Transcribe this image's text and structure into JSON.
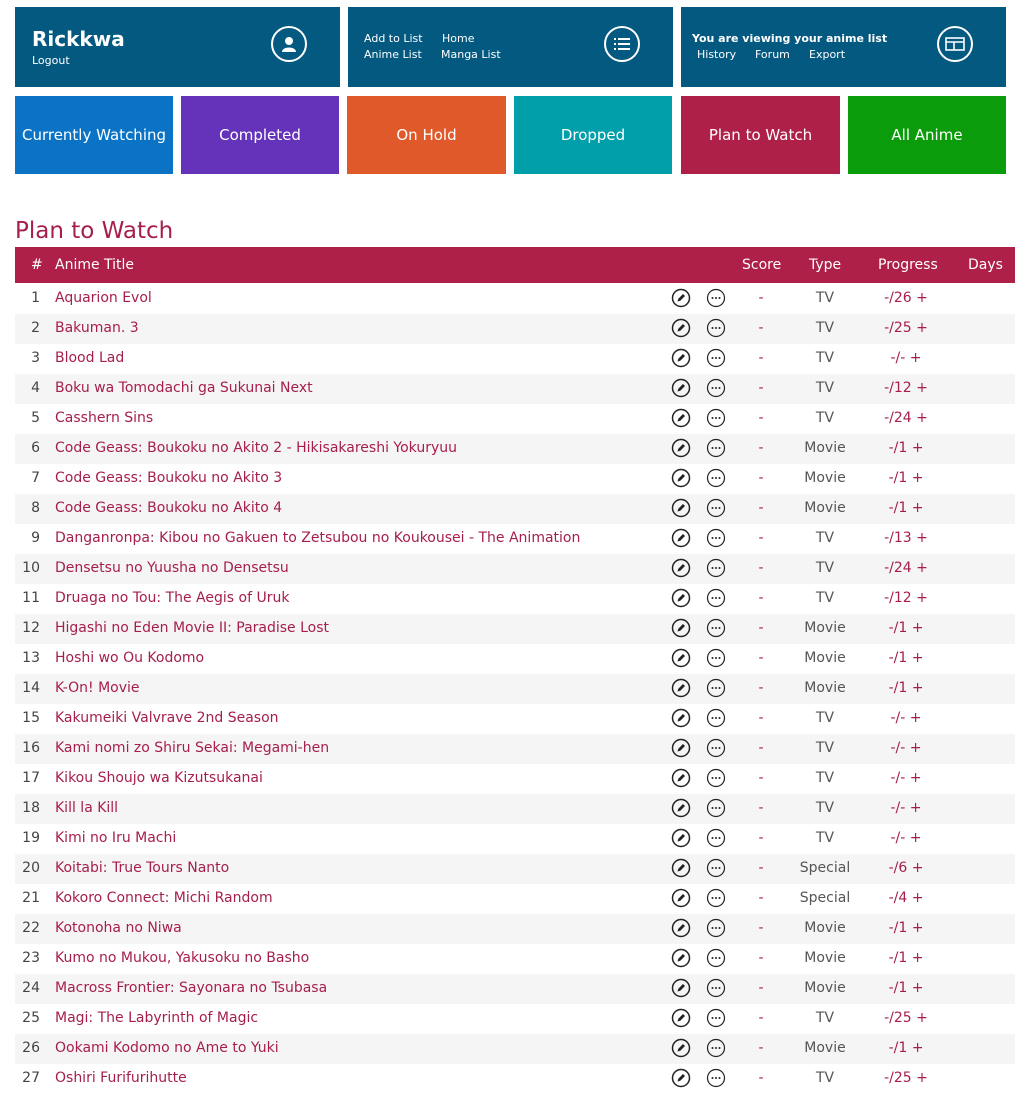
{
  "header": {
    "user_name": "Rickkwa",
    "logout": "Logout",
    "nav": {
      "add_to_list": "Add to List",
      "home": "Home",
      "anime_list": "Anime List",
      "manga_list": "Manga List"
    },
    "viewing_text": "You are viewing your anime list",
    "links": {
      "history": "History",
      "forum": "Forum",
      "export": "Export"
    },
    "tile_color": "#045980"
  },
  "categories": [
    {
      "label": "Currently Watching",
      "color": "#0a73c5"
    },
    {
      "label": "Completed",
      "color": "#6433b9"
    },
    {
      "label": "On Hold",
      "color": "#e0592b"
    },
    {
      "label": "Dropped",
      "color": "#009faa"
    },
    {
      "label": "Plan to Watch",
      "color": "#ae2047"
    },
    {
      "label": "All Anime",
      "color": "#0a9c0a"
    }
  ],
  "list_heading": "Plan to Watch",
  "table": {
    "columns": {
      "num": "#",
      "title": "Anime Title",
      "score": "Score",
      "type": "Type",
      "progress": "Progress",
      "days": "Days"
    },
    "rows": [
      {
        "num": "1",
        "title": "Aquarion Evol",
        "score": "-",
        "type": "TV",
        "progress": "-/26 +"
      },
      {
        "num": "2",
        "title": "Bakuman. 3",
        "score": "-",
        "type": "TV",
        "progress": "-/25 +"
      },
      {
        "num": "3",
        "title": "Blood Lad",
        "score": "-",
        "type": "TV",
        "progress": "-/- +"
      },
      {
        "num": "4",
        "title": "Boku wa Tomodachi ga Sukunai Next",
        "score": "-",
        "type": "TV",
        "progress": "-/12 +"
      },
      {
        "num": "5",
        "title": "Casshern Sins",
        "score": "-",
        "type": "TV",
        "progress": "-/24 +"
      },
      {
        "num": "6",
        "title": "Code Geass: Boukoku no Akito 2 - Hikisakareshi Yokuryuu",
        "score": "-",
        "type": "Movie",
        "progress": "-/1 +"
      },
      {
        "num": "7",
        "title": "Code Geass: Boukoku no Akito 3",
        "score": "-",
        "type": "Movie",
        "progress": "-/1 +"
      },
      {
        "num": "8",
        "title": "Code Geass: Boukoku no Akito 4",
        "score": "-",
        "type": "Movie",
        "progress": "-/1 +"
      },
      {
        "num": "9",
        "title": "Danganronpa: Kibou no Gakuen to Zetsubou no Koukousei - The Animation",
        "score": "-",
        "type": "TV",
        "progress": "-/13 +"
      },
      {
        "num": "10",
        "title": "Densetsu no Yuusha no Densetsu",
        "score": "-",
        "type": "TV",
        "progress": "-/24 +"
      },
      {
        "num": "11",
        "title": "Druaga no Tou: The Aegis of Uruk",
        "score": "-",
        "type": "TV",
        "progress": "-/12 +"
      },
      {
        "num": "12",
        "title": "Higashi no Eden Movie II: Paradise Lost",
        "score": "-",
        "type": "Movie",
        "progress": "-/1 +"
      },
      {
        "num": "13",
        "title": "Hoshi wo Ou Kodomo",
        "score": "-",
        "type": "Movie",
        "progress": "-/1 +"
      },
      {
        "num": "14",
        "title": "K-On! Movie",
        "score": "-",
        "type": "Movie",
        "progress": "-/1 +"
      },
      {
        "num": "15",
        "title": "Kakumeiki Valvrave 2nd Season",
        "score": "-",
        "type": "TV",
        "progress": "-/- +"
      },
      {
        "num": "16",
        "title": "Kami nomi zo Shiru Sekai: Megami-hen",
        "score": "-",
        "type": "TV",
        "progress": "-/- +"
      },
      {
        "num": "17",
        "title": "Kikou Shoujo wa Kizutsukanai",
        "score": "-",
        "type": "TV",
        "progress": "-/- +"
      },
      {
        "num": "18",
        "title": "Kill la Kill",
        "score": "-",
        "type": "TV",
        "progress": "-/- +"
      },
      {
        "num": "19",
        "title": "Kimi no Iru Machi",
        "score": "-",
        "type": "TV",
        "progress": "-/- +"
      },
      {
        "num": "20",
        "title": "Koitabi: True Tours Nanto",
        "score": "-",
        "type": "Special",
        "progress": "-/6 +"
      },
      {
        "num": "21",
        "title": "Kokoro Connect: Michi Random",
        "score": "-",
        "type": "Special",
        "progress": "-/4 +"
      },
      {
        "num": "22",
        "title": "Kotonoha no Niwa",
        "score": "-",
        "type": "Movie",
        "progress": "-/1 +"
      },
      {
        "num": "23",
        "title": "Kumo no Mukou, Yakusoku no Basho",
        "score": "-",
        "type": "Movie",
        "progress": "-/1 +"
      },
      {
        "num": "24",
        "title": "Macross Frontier: Sayonara no Tsubasa",
        "score": "-",
        "type": "Movie",
        "progress": "-/1 +"
      },
      {
        "num": "25",
        "title": "Magi: The Labyrinth of Magic",
        "score": "-",
        "type": "TV",
        "progress": "-/25 +"
      },
      {
        "num": "26",
        "title": "Ookami Kodomo no Ame to Yuki",
        "score": "-",
        "type": "Movie",
        "progress": "-/1 +"
      },
      {
        "num": "27",
        "title": "Oshiri Furifurihutte",
        "score": "-",
        "type": "TV",
        "progress": "-/25 +"
      }
    ]
  }
}
